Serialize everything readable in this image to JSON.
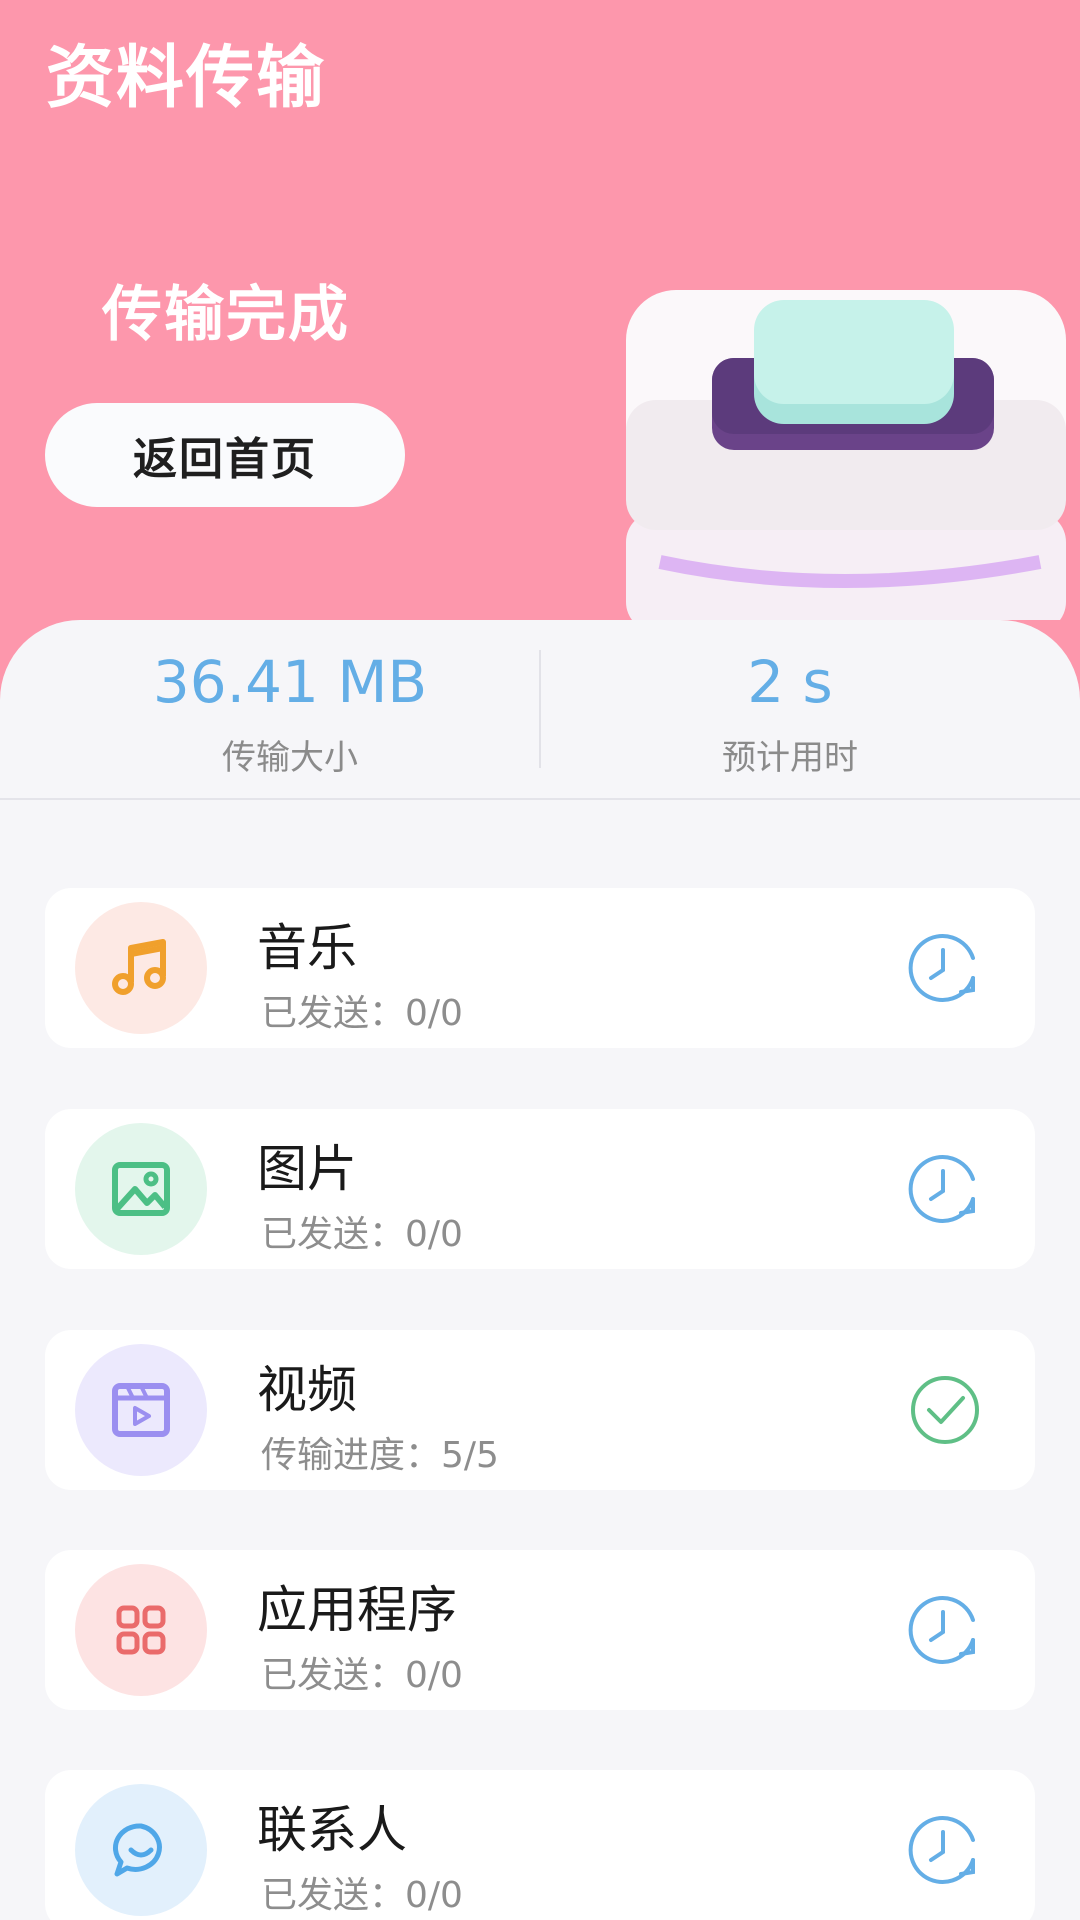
{
  "header": {
    "app_title": "资料传输",
    "status_title": "传输完成",
    "home_button_label": "返回首页"
  },
  "stats": {
    "size_value": "36.41 MB",
    "size_label": "传输大小",
    "time_value": "2 s",
    "time_label": "预计用时"
  },
  "items": [
    {
      "name": "音乐",
      "status": "已发送：0/0",
      "icon": "music-note-icon",
      "state_icon": "clock-pending-icon",
      "icon_color": "#f0a02c",
      "icon_bg": "#fde9e4"
    },
    {
      "name": "图片",
      "status": "已发送：0/0",
      "icon": "image-icon",
      "state_icon": "clock-pending-icon",
      "icon_color": "#4cbf85",
      "icon_bg": "#e3f6ec"
    },
    {
      "name": "视频",
      "status": "传输进度：5/5",
      "icon": "video-icon",
      "state_icon": "check-circle-icon",
      "icon_color": "#9b8ff0",
      "icon_bg": "#ece9fd"
    },
    {
      "name": "应用程序",
      "status": "已发送：0/0",
      "icon": "apps-grid-icon",
      "state_icon": "clock-pending-icon",
      "icon_color": "#ea6b6b",
      "icon_bg": "#fde3e3"
    },
    {
      "name": "联系人",
      "status": "已发送：0/0",
      "icon": "contact-chat-icon",
      "state_icon": "clock-pending-icon",
      "icon_color": "#4fa7e8",
      "icon_bg": "#e2f0fc"
    }
  ],
  "colors": {
    "header_bg": "#fd97ac",
    "stat_value": "#64aee6",
    "pending_icon": "#64aee6",
    "done_icon": "#5fbf86"
  }
}
